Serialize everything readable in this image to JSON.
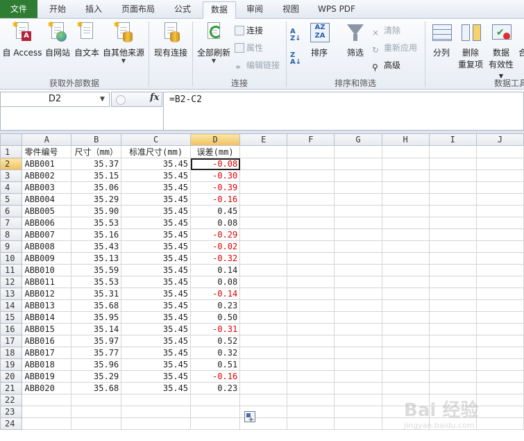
{
  "tabs": [
    "文件",
    "开始",
    "插入",
    "页面布局",
    "公式",
    "数据",
    "审阅",
    "视图",
    "WPS PDF"
  ],
  "active_tab": "数据",
  "ribbon": {
    "groups": {
      "external": "获取外部数据",
      "connections": "连接",
      "sort_filter": "排序和筛选",
      "data_tools": "数据工具"
    },
    "buttons": {
      "access": "自 Access",
      "web": "自网站",
      "text": "自文本",
      "other_sources": "自其他来源",
      "existing_conn": "现有连接",
      "refresh_all": "全部刷新",
      "connections": "连接",
      "properties": "属性",
      "edit_links": "编辑链接",
      "sort": "排序",
      "filter": "筛选",
      "clear": "清除",
      "reapply": "重新应用",
      "advanced": "高级",
      "text_to_columns": "分列",
      "remove_dup_1": "删除",
      "remove_dup_2": "重复项",
      "validation_1": "数据",
      "validation_2": "有效性",
      "extra": "合"
    }
  },
  "formula_bar": {
    "name_box": "D2",
    "fx": "fx",
    "formula": "=B2-C2"
  },
  "columns": [
    "A",
    "B",
    "C",
    "D",
    "E",
    "F",
    "G",
    "H",
    "I",
    "J"
  ],
  "header_row": [
    "零件编号",
    "尺寸（mm）",
    "标准尺寸(mm)",
    "误差(mm)"
  ],
  "rows": [
    [
      "ABB001",
      "35.37",
      "35.45",
      "-0.08"
    ],
    [
      "ABB002",
      "35.15",
      "35.45",
      "-0.30"
    ],
    [
      "ABB003",
      "35.06",
      "35.45",
      "-0.39"
    ],
    [
      "ABB004",
      "35.29",
      "35.45",
      "-0.16"
    ],
    [
      "ABB005",
      "35.90",
      "35.45",
      "0.45"
    ],
    [
      "ABB006",
      "35.53",
      "35.45",
      "0.08"
    ],
    [
      "ABB007",
      "35.16",
      "35.45",
      "-0.29"
    ],
    [
      "ABB008",
      "35.43",
      "35.45",
      "-0.02"
    ],
    [
      "ABB009",
      "35.13",
      "35.45",
      "-0.32"
    ],
    [
      "ABB010",
      "35.59",
      "35.45",
      "0.14"
    ],
    [
      "ABB011",
      "35.53",
      "35.45",
      "0.08"
    ],
    [
      "ABB012",
      "35.31",
      "35.45",
      "-0.14"
    ],
    [
      "ABB013",
      "35.68",
      "35.45",
      "0.23"
    ],
    [
      "ABB014",
      "35.95",
      "35.45",
      "0.50"
    ],
    [
      "ABB015",
      "35.14",
      "35.45",
      "-0.31"
    ],
    [
      "ABB016",
      "35.97",
      "35.45",
      "0.52"
    ],
    [
      "ABB017",
      "35.77",
      "35.45",
      "0.32"
    ],
    [
      "ABB018",
      "35.96",
      "35.45",
      "0.51"
    ],
    [
      "ABB019",
      "35.29",
      "35.45",
      "-0.16"
    ],
    [
      "ABB020",
      "35.68",
      "35.45",
      "0.23"
    ]
  ],
  "row_numbers": [
    "1",
    "2",
    "3",
    "4",
    "5",
    "6",
    "7",
    "8",
    "9",
    "10",
    "11",
    "12",
    "13",
    "14",
    "15",
    "16",
    "17",
    "18",
    "19",
    "20",
    "21",
    "22",
    "23",
    "24"
  ],
  "selected_cell": "D2",
  "negative_color": "#e00000",
  "file_tab_color": "#2e7d32",
  "watermark": {
    "text": "Bai 经验",
    "sub": "jingyan.baidu.com"
  }
}
